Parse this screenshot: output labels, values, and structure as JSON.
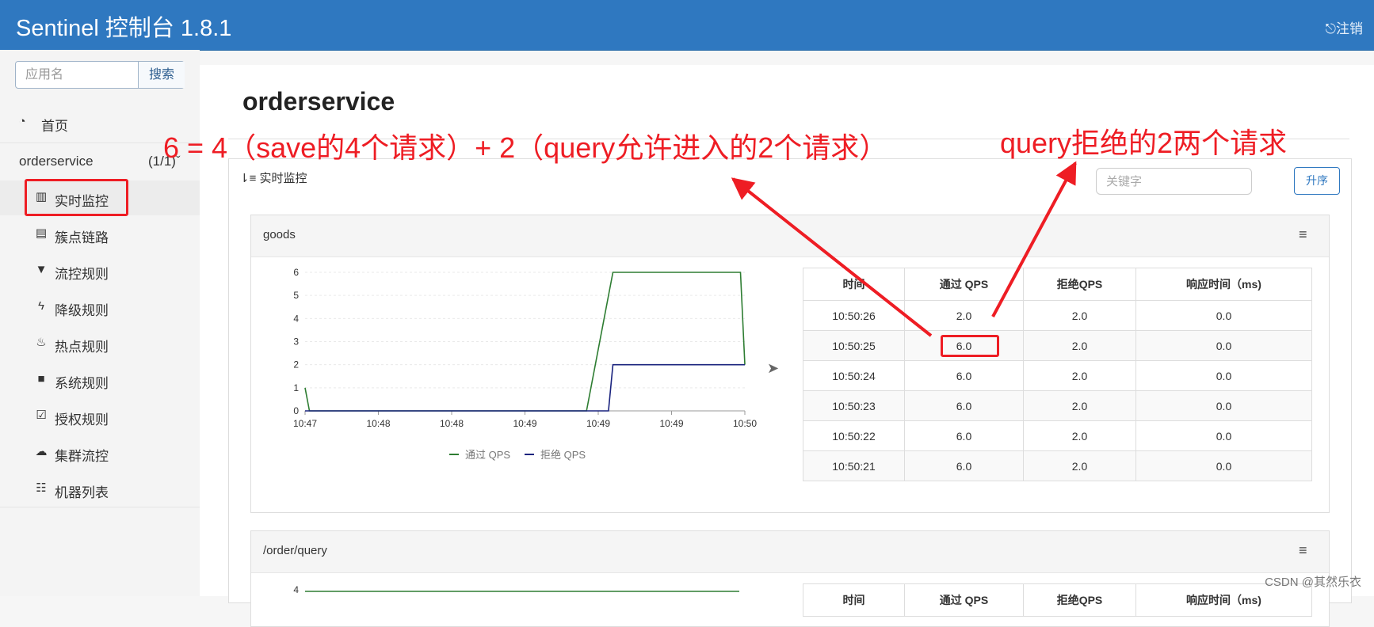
{
  "header": {
    "brand": "Sentinel 控制台 1.8.1",
    "logout": "注销"
  },
  "sidebar": {
    "search_placeholder": "应用名",
    "search_button": "搜索",
    "home": "首页",
    "app_name": "orderservice",
    "app_count": "(1/1)",
    "items": [
      {
        "label": "实时监控",
        "icon": "bar-chart-icon"
      },
      {
        "label": "簇点链路",
        "icon": "list-icon"
      },
      {
        "label": "流控规则",
        "icon": "filter-icon"
      },
      {
        "label": "降级规则",
        "icon": "bolt-icon"
      },
      {
        "label": "热点规则",
        "icon": "fire-icon"
      },
      {
        "label": "系统规则",
        "icon": "lock-icon"
      },
      {
        "label": "授权规则",
        "icon": "check-icon"
      },
      {
        "label": "集群流控",
        "icon": "cloud-icon"
      },
      {
        "label": "机器列表",
        "icon": "th-list-icon"
      }
    ]
  },
  "main": {
    "page_title": "orderservice",
    "panel_title": "实时监控",
    "keyword_placeholder": "关键字",
    "sort_button": "升序"
  },
  "cards": [
    {
      "title": "goods",
      "table": {
        "headers": [
          "时间",
          "通过 QPS",
          "拒绝QPS",
          "响应时间（ms)"
        ],
        "rows": [
          [
            "10:50:26",
            "2.0",
            "2.0",
            "0.0"
          ],
          [
            "10:50:25",
            "6.0",
            "2.0",
            "0.0"
          ],
          [
            "10:50:24",
            "6.0",
            "2.0",
            "0.0"
          ],
          [
            "10:50:23",
            "6.0",
            "2.0",
            "0.0"
          ],
          [
            "10:50:22",
            "6.0",
            "2.0",
            "0.0"
          ],
          [
            "10:50:21",
            "6.0",
            "2.0",
            "0.0"
          ]
        ]
      }
    },
    {
      "title": "/order/query",
      "table_headers": [
        "时间",
        "通过 QPS",
        "拒绝QPS",
        "响应时间（ms)"
      ]
    }
  ],
  "chart_data": [
    {
      "type": "line",
      "x_ticks": [
        "10:47",
        "10:48",
        "10:48",
        "10:49",
        "10:49",
        "10:49",
        "10:50"
      ],
      "ylim": [
        0,
        6
      ],
      "y_ticks": [
        0,
        1,
        2,
        3,
        4,
        5,
        6
      ],
      "series": [
        {
          "name": "通过 QPS",
          "color": "#2e7d32",
          "points": [
            [
              0.0,
              1
            ],
            [
              0.01,
              0
            ],
            [
              0.64,
              0
            ],
            [
              0.7,
              6
            ],
            [
              0.99,
              6
            ],
            [
              1.0,
              2
            ]
          ]
        },
        {
          "name": "拒绝 QPS",
          "color": "#1a237e",
          "points": [
            [
              0.0,
              0
            ],
            [
              0.69,
              0
            ],
            [
              0.7,
              2
            ],
            [
              1.0,
              2
            ]
          ]
        }
      ],
      "legend": "bottom"
    },
    {
      "type": "line",
      "y_ticks": [
        4
      ],
      "series": [
        {
          "name": "通过 QPS",
          "color": "#2e7d32",
          "points": [
            [
              0.0,
              4
            ],
            [
              1.0,
              4
            ]
          ]
        }
      ]
    }
  ],
  "annotations": {
    "left": "6 = 4（save的4个请求）+ 2（query允许进入的2个请求）",
    "right": "query拒绝的2两个请求",
    "color": "#ee1d24"
  },
  "watermark": "CSDN @其然乐衣"
}
